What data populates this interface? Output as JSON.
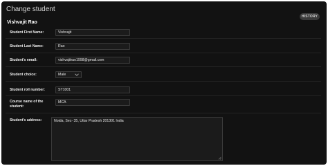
{
  "header": {
    "title": "Change student",
    "history_label": "HISTORY"
  },
  "object": {
    "name": "Vishvajit Rao"
  },
  "fields": {
    "first_name": {
      "label": "Student First Name:",
      "value": "Vishvajit"
    },
    "last_name": {
      "label": "Student Last Name:",
      "value": "Rao"
    },
    "email": {
      "label": "Student's email:",
      "value": "vishvajitrao1998@gmail.com"
    },
    "choice": {
      "label": "Student choice:",
      "value": "Male"
    },
    "roll_number": {
      "label": "Student roll number:",
      "value": "ST1001"
    },
    "course": {
      "label": "Course name of the student:",
      "value": "MCA"
    },
    "address": {
      "label": "Student's address:",
      "value": "Noida, Sec- 35, Uttar Pradesh 201301 India"
    }
  },
  "colors": {
    "background": "#121212",
    "field_background": "#1b1b1b",
    "field_border": "#3b3b3b",
    "history_button": "#3a3a3a"
  },
  "icons": {
    "select_indicator": "chevron-down-icon",
    "textarea_corner": "resize-handle-icon"
  }
}
